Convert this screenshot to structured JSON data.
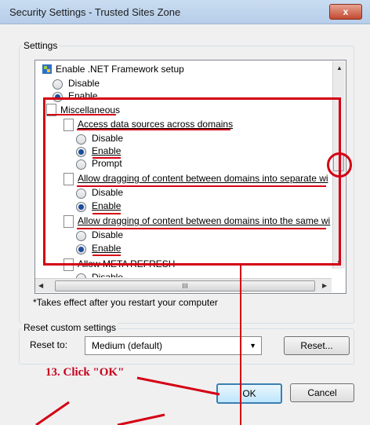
{
  "window": {
    "title": "Security Settings - Trusted Sites Zone",
    "close_label": "x"
  },
  "settings": {
    "group_label": "Settings",
    "items": [
      {
        "kind": "category",
        "icon": "net-framework-icon",
        "label": "Enable .NET Framework setup"
      },
      {
        "kind": "option",
        "label": "Disable",
        "selected": false
      },
      {
        "kind": "option",
        "label": "Enable",
        "selected": true
      },
      {
        "kind": "category",
        "icon": "document-icon",
        "label": "Miscellaneous"
      },
      {
        "kind": "setting",
        "icon": "document-icon",
        "label": "Access data sources across domains"
      },
      {
        "kind": "option",
        "label": "Disable",
        "selected": false
      },
      {
        "kind": "option",
        "label": "Enable",
        "selected": true
      },
      {
        "kind": "option",
        "label": "Prompt",
        "selected": false
      },
      {
        "kind": "setting",
        "icon": "document-icon",
        "label": "Allow dragging of content between domains into separate wi"
      },
      {
        "kind": "option",
        "label": "Disable",
        "selected": false
      },
      {
        "kind": "option",
        "label": "Enable",
        "selected": true
      },
      {
        "kind": "setting",
        "icon": "document-icon",
        "label": "Allow dragging of content between domains into the same wi"
      },
      {
        "kind": "option",
        "label": "Disable",
        "selected": false
      },
      {
        "kind": "option",
        "label": "Enable",
        "selected": true
      },
      {
        "kind": "setting",
        "icon": "document-icon",
        "label": "Allow META REFRESH"
      },
      {
        "kind": "option",
        "label": "Disable",
        "selected": false
      }
    ],
    "hscroll_grip": "III",
    "note": "*Takes effect after you restart your computer"
  },
  "reset": {
    "group_label": "Reset custom settings",
    "reset_to_label": "Reset to:",
    "combo_value": "Medium (default)",
    "reset_button": "Reset..."
  },
  "buttons": {
    "ok": "OK",
    "cancel": "Cancel"
  },
  "annotation": {
    "step_text": "13. Click \"OK\"",
    "color": "#d40014"
  }
}
